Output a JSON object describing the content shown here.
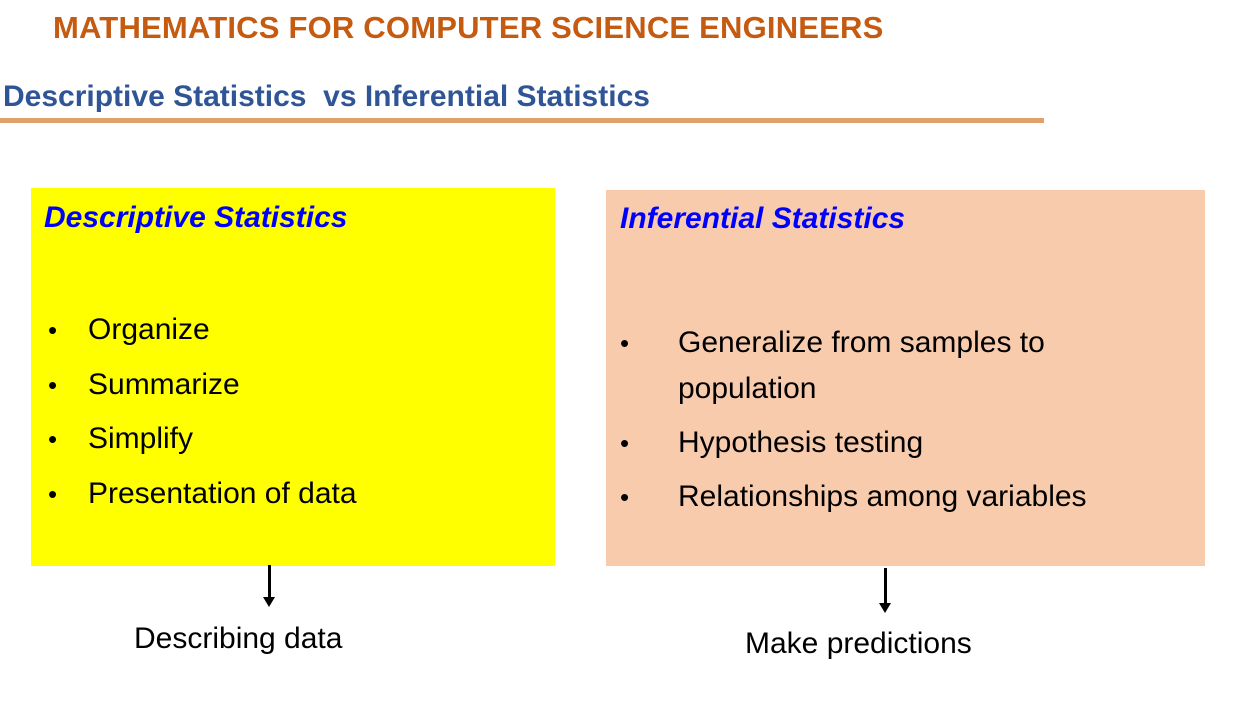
{
  "header": {
    "course_title": "MATHEMATICS FOR COMPUTER SCIENCE ENGINEERS",
    "slide_title": "Descriptive Statistics  vs Inferential Statistics"
  },
  "descriptive": {
    "heading": "Descriptive Statistics",
    "bullet_symbol": "•",
    "items": [
      "Organize",
      "Summarize",
      "Simplify",
      "Presentation of data"
    ],
    "caption": "Describing data",
    "box_color": "#FFFF00"
  },
  "inferential": {
    "heading": "Inferential Statistics",
    "bullet_symbol": "•",
    "items": [
      "Generalize from samples to population",
      "Hypothesis testing",
      "Relationships among variables"
    ],
    "caption": "Make predictions",
    "box_color": "#F8CBAD"
  },
  "colors": {
    "course_title": "#C55A11",
    "slide_title": "#2F5597",
    "box_heading": "#0000FF",
    "rule": "#E0A26A"
  }
}
